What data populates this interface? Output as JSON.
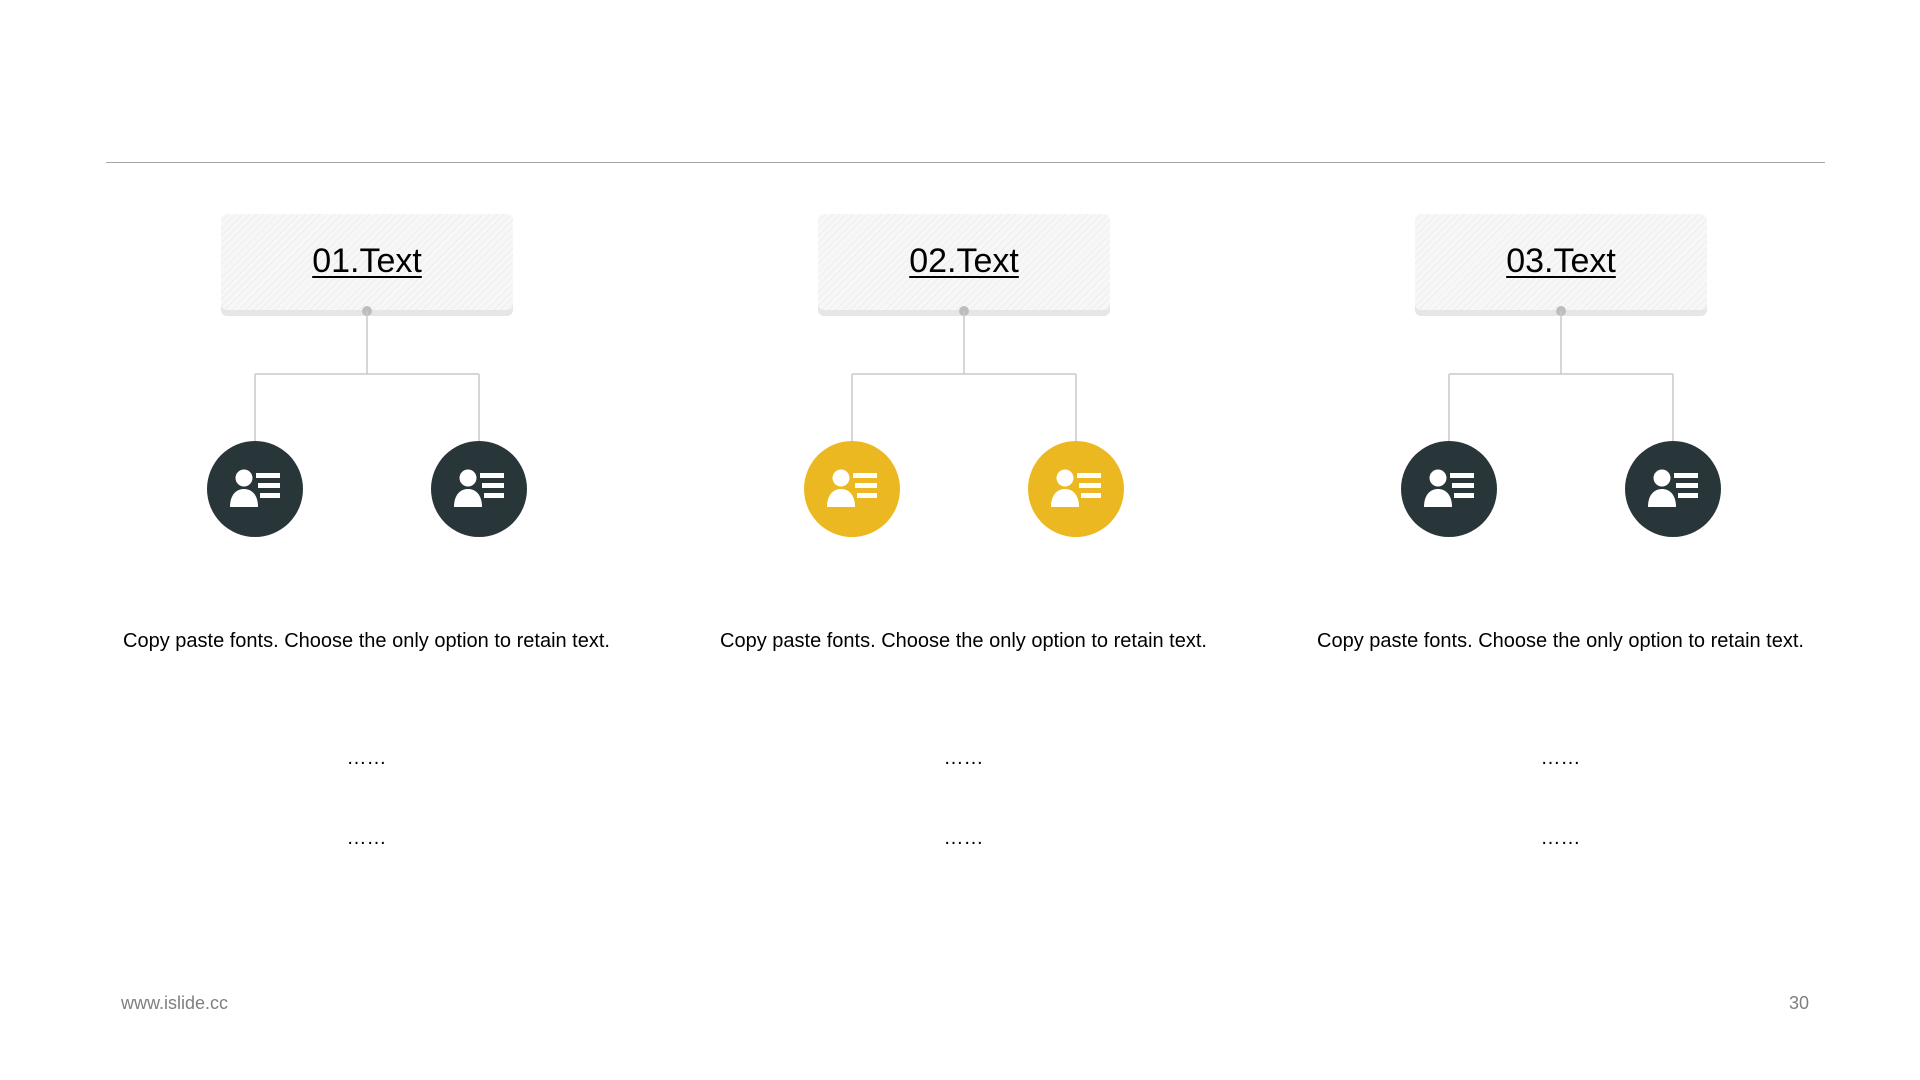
{
  "colors": {
    "dark": "#283639",
    "accent": "#ebb822",
    "line": "#c8c8c8",
    "rule": "#a6a6a6"
  },
  "columns": [
    {
      "title": "01.Text",
      "icon_color": "dark",
      "icons": [
        "contact-card-icon",
        "contact-card-icon"
      ],
      "description": "Copy paste fonts. Choose the only option to retain text.",
      "line1": "……",
      "line2": "……"
    },
    {
      "title": "02.Text",
      "icon_color": "accent",
      "icons": [
        "contact-card-icon",
        "contact-card-icon"
      ],
      "description": "Copy paste fonts. Choose the only option to retain text.",
      "line1": "……",
      "line2": "……"
    },
    {
      "title": "03.Text",
      "icon_color": "dark",
      "icons": [
        "contact-card-icon",
        "contact-card-icon"
      ],
      "description": "Copy paste fonts. Choose the only option to retain text.",
      "line1": "……",
      "line2": "……"
    }
  ],
  "footer": {
    "website": "www.islide.cc",
    "page_number": "30"
  }
}
